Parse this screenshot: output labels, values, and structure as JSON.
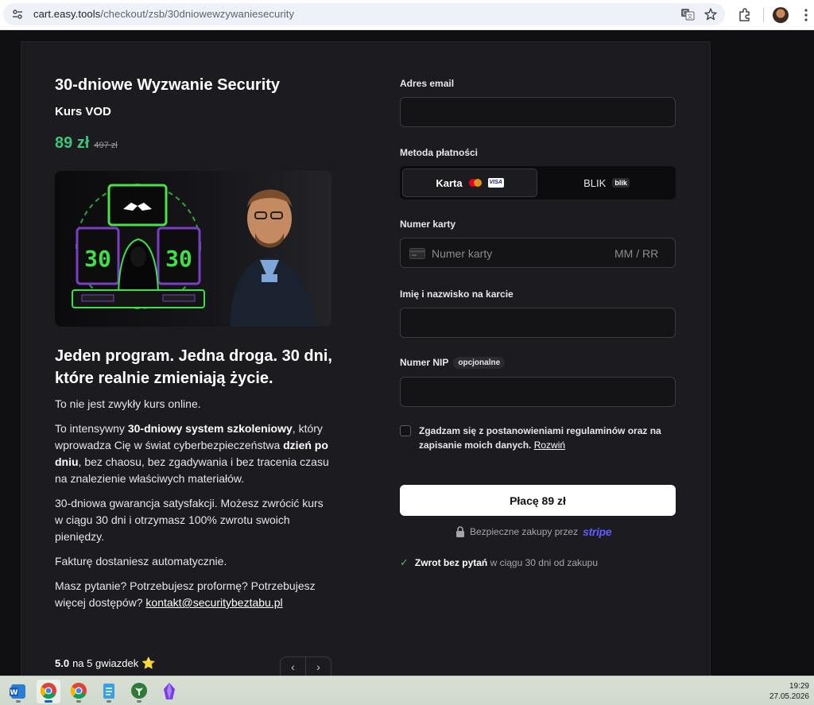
{
  "browser": {
    "url_host": "cart.easy.tools",
    "url_path": "/checkout/zsb/30dniowewzywaniesecurity"
  },
  "product": {
    "title": "30-dniowe Wyzwanie Security",
    "subtitle": "Kurs VOD",
    "price": "89 zł",
    "old_price": "497 zł",
    "hero_image_text": "30"
  },
  "description": {
    "headline": "Jeden program. Jedna droga. 30 dni, które realnie zmieniają życie.",
    "p1": "To nie jest zwykły kurs online.",
    "p2": {
      "t1": "To intensywny ",
      "b1": "30-dniowy system szkoleniowy",
      "t2": ", który wprowadza Cię w świat cyberbezpieczeństwa ",
      "b2": "dzień po dniu",
      "t3": ", bez chaosu, bez zgadywania i bez tracenia czasu na znalezienie właściwych materiałów."
    },
    "p3": "30-dniowa gwarancja satysfakcji. Możesz zwrócić kurs w ciągu 30 dni i otrzymasz 100% zwrotu swoich pieniędzy.",
    "p4": "Fakturę dostaniesz automatycznie.",
    "p5_text": "Masz pytanie? Potrzebujesz proformę? Potrzebujesz więcej dostępów? ",
    "p5_link": "kontakt@securitybeztabu.pl"
  },
  "rating": {
    "score": "5.0",
    "rest": "na 5 gwiazdek",
    "star": "⭐",
    "prev": "‹",
    "next": "›"
  },
  "form": {
    "email_label": "Adres email",
    "email_value": "",
    "method_label": "Metoda płatności",
    "method_card": "Karta",
    "visa": "VISA",
    "method_blik": "BLIK",
    "blik_badge": "blik",
    "card_label": "Numer karty",
    "card_placeholder": "Numer karty",
    "expiry_placeholder": "MM / RR",
    "name_label": "Imię i nazwisko na karcie",
    "name_value": "",
    "nip_label": "Numer NIP",
    "nip_optional": "opcjonalne",
    "nip_value": "",
    "terms_text": "Zgadzam się z postanowieniami regulaminów oraz na zapisanie moich danych.",
    "terms_link": "Rozwiń",
    "pay_button": "Płacę 89 zł",
    "secure_text": "Bezpieczne zakupy przez",
    "stripe": "stripe",
    "refund_bold": "Zwrot bez pytań",
    "refund_rest": "w ciągu 30 dni od zakupu"
  },
  "taskbar": {
    "time": "19:29",
    "date": "27.05.2026"
  },
  "colors": {
    "accent_green": "#3ec47a",
    "stripe_purple": "#635bff",
    "background": "#1c1c20"
  }
}
